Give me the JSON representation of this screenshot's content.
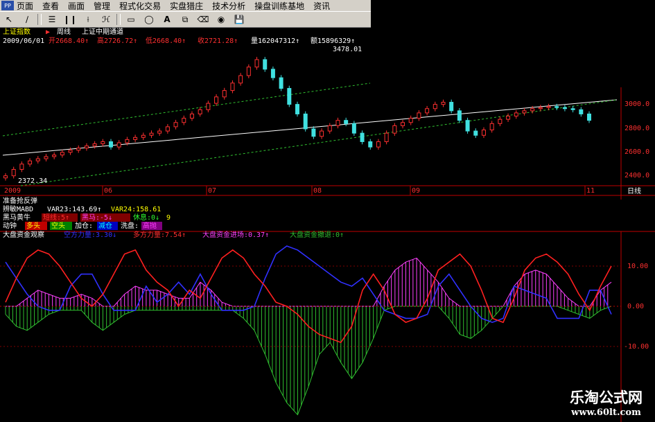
{
  "menubar": {
    "items": [
      "页面",
      "查看",
      "画面",
      "管理",
      "程式化交易",
      "实盘猎庄",
      "技术分析",
      "操盘训练基地",
      "资讯"
    ]
  },
  "toolbar": {
    "icons": [
      "cursor-icon",
      "line-icon",
      "channel-icon",
      "fan-lines-icon",
      "gann-fan-icon",
      "parallel-lines-icon",
      "rectangle-icon",
      "ellipse-icon",
      "text-icon",
      "copy-icon",
      "eraser-icon",
      "lock-icon",
      "save-icon"
    ]
  },
  "header": {
    "index_name": "上证指数",
    "period": "周线",
    "formula": "上证中期通道",
    "date": "2009/06/01",
    "open": "开2668.40↑",
    "high": "高2726.72↑",
    "low": "低2668.40↑",
    "close": "收2721.28↑",
    "volume": "量162047312↑",
    "amount": "额15896329↑"
  },
  "main_chart": {
    "high_label": "3478.01",
    "low_label": "2372.34",
    "y_ticks": [
      "3000.0",
      "2800.0",
      "2600.0",
      "2400.0"
    ],
    "x_ticks": [
      "2009",
      "06",
      "07",
      "08",
      "09",
      "11"
    ],
    "period_tag": "日线"
  },
  "indicators": {
    "line1": "准备抢反弹",
    "line2": {
      "name": "辨敏MABD",
      "var23": "VAR23:143.69↑",
      "var24": "VAR24:158.61"
    },
    "line3": {
      "name": "黑马黄牛",
      "a": "短线:5↑",
      "b": "黑马:-5↓",
      "c": "休息:0↓",
      "d": "9"
    },
    "line4": {
      "name": "动钟",
      "a": "多头",
      "b": "空头",
      "c": "加仓:",
      "d": "减仓",
      "e": "洗盘:",
      "f": "高抛"
    },
    "line5": {
      "name": "大盘资金观察",
      "a": "空方力量:3.30↓",
      "b": "多方力量:7.54↑",
      "c": "大盘资金进场:0.37↑",
      "d": "大盘资金撤退:0↑"
    }
  },
  "sub_chart": {
    "y_ticks": [
      "10.00",
      "0.00",
      "-10.00"
    ]
  },
  "watermark": {
    "title": "乐淘公式网",
    "url": "www.60lt.com"
  },
  "colors": {
    "up_candle": "#ff3030",
    "down_candle": "#40e0e0",
    "channel": "#30c030",
    "midline": "#ffffff",
    "bear_power": "#3030ff",
    "bull_power": "#ff2020",
    "inflow_bar": "#ff40ff",
    "outflow_bar": "#30c030",
    "axis": "#c00000"
  },
  "chart_data": [
    {
      "type": "candlestick",
      "title": "上证中期通道",
      "x_tick_labels": [
        "2009",
        "06",
        "07",
        "08",
        "09",
        "11"
      ],
      "ylim": [
        2300,
        3600
      ],
      "y_ticks": [
        2400,
        2600,
        2800,
        3000
      ],
      "annotations": [
        {
          "label": "3478.01"
        },
        {
          "label": "2372.34"
        }
      ],
      "close": [
        2380,
        2440,
        2490,
        2520,
        2540,
        2560,
        2575,
        2600,
        2620,
        2640,
        2660,
        2680,
        2700,
        2650,
        2690,
        2720,
        2740,
        2760,
        2780,
        2800,
        2840,
        2880,
        2920,
        2960,
        3000,
        3060,
        3120,
        3180,
        3250,
        3320,
        3400,
        3470,
        3380,
        3300,
        3200,
        3050,
        2960,
        2820,
        2750,
        2800,
        2850,
        2900,
        2870,
        2780,
        2700,
        2650,
        2700,
        2780,
        2850,
        2880,
        2920,
        2970,
        3010,
        3050,
        3070,
        2990,
        2900,
        2800,
        2760,
        2810,
        2870,
        2910,
        2940,
        2970,
        2990,
        3010,
        3020,
        3030,
        3020,
        3010,
        3000,
        2960,
        2900
      ]
    },
    {
      "type": "line",
      "title": "大盘资金观察",
      "ylim": [
        -15,
        15
      ],
      "y_ticks": [
        10,
        0,
        -10
      ],
      "series": [
        {
          "name": "空方力量",
          "values": [
            11,
            7,
            3,
            0,
            -1,
            -1,
            5,
            8,
            8,
            3,
            -1,
            -1,
            -1,
            5,
            1,
            3,
            6,
            3,
            8,
            3,
            -1,
            -1,
            -1,
            0,
            7,
            13,
            15,
            14,
            12,
            10,
            8,
            6,
            5,
            7,
            3,
            -1,
            -2,
            -3,
            -3,
            -2,
            5,
            8,
            4,
            0,
            -3,
            -4,
            -3,
            5,
            4,
            3,
            2,
            -3,
            -3,
            -3,
            4,
            4,
            -2
          ]
        },
        {
          "name": "多方力量",
          "values": [
            1,
            7,
            12,
            14,
            13,
            10,
            6,
            2,
            0,
            3,
            8,
            13,
            14,
            9,
            6,
            4,
            0,
            4,
            2,
            7,
            12,
            14,
            12,
            8,
            5,
            1,
            0,
            -2,
            -5,
            -7,
            -8,
            -9,
            -5,
            4,
            8,
            4,
            -2,
            -4,
            -3,
            2,
            9,
            11,
            13,
            10,
            4,
            -3,
            -4,
            2,
            9,
            12,
            13,
            11,
            8,
            3,
            -1,
            5,
            10
          ]
        },
        {
          "name": "大盘资金进场",
          "values": [
            0,
            0,
            2,
            4,
            3,
            2,
            2,
            3,
            2,
            0,
            0,
            3,
            5,
            4,
            4,
            3,
            2,
            2,
            6,
            4,
            1,
            0,
            0,
            0,
            0,
            0,
            0,
            0,
            0,
            0,
            0,
            0,
            0,
            0,
            0,
            5,
            9,
            11,
            12,
            9,
            6,
            2,
            0,
            0,
            0,
            0,
            0,
            5,
            8,
            9,
            8,
            5,
            2,
            0,
            0,
            4,
            6
          ]
        },
        {
          "name": "大盘资金撤退",
          "values": [
            -2,
            -5,
            -6,
            -4,
            -2,
            -1,
            -1,
            -1,
            -4,
            -6,
            -4,
            -2,
            -1,
            -1,
            -1,
            -1,
            -1,
            -1,
            -1,
            -1,
            -1,
            -1,
            -3,
            -6,
            -12,
            -19,
            -24,
            -27,
            -20,
            -12,
            -9,
            -14,
            -18,
            -14,
            -8,
            -1,
            0,
            0,
            0,
            0,
            0,
            -3,
            -7,
            -8,
            -6,
            -3,
            0,
            0,
            0,
            0,
            0,
            0,
            -1,
            -2,
            -3,
            -1,
            0
          ]
        }
      ]
    }
  ]
}
